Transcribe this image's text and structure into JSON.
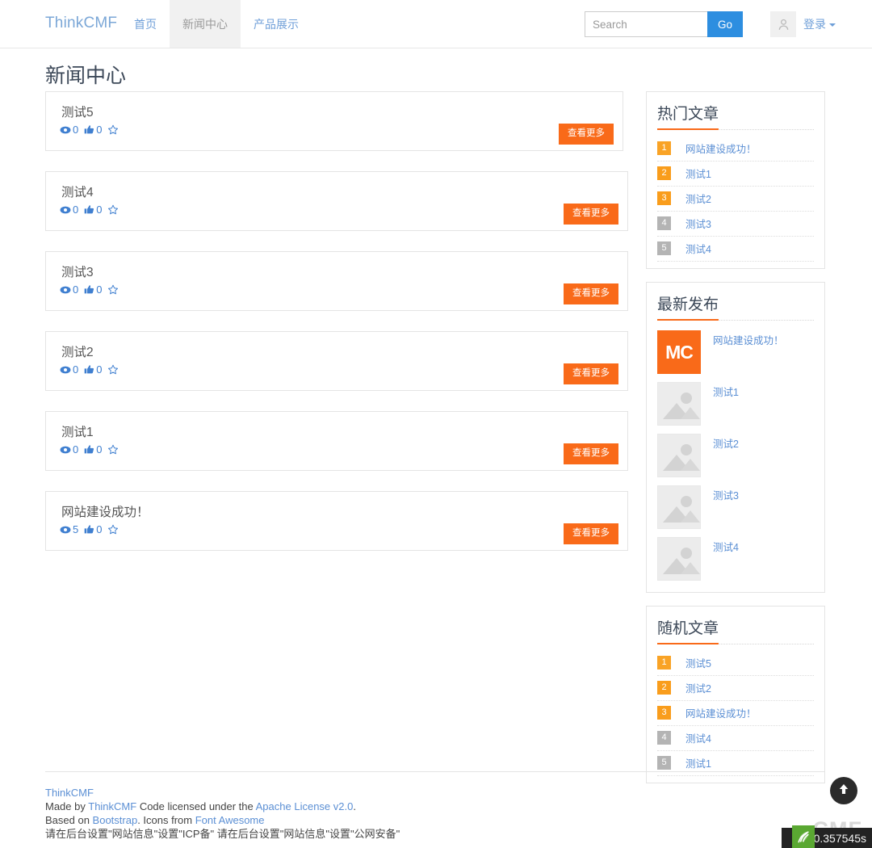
{
  "navbar": {
    "brand": "ThinkCMF",
    "links": [
      {
        "label": "首页",
        "active": false
      },
      {
        "label": "新闻中心",
        "active": true
      },
      {
        "label": "产品展示",
        "active": false
      }
    ],
    "search": {
      "placeholder": "Search",
      "value": "",
      "button_label": "Go"
    },
    "user": {
      "login_label": "登录",
      "avatar_icon": "user-icon",
      "caret_icon": "caret-down-icon"
    }
  },
  "page": {
    "title": "新闻中心"
  },
  "articles": {
    "more_label": "查看更多",
    "view_icon": "eye-icon",
    "like_icon": "thumbs-up-icon",
    "star_icon": "star-outline-icon",
    "items": [
      {
        "title": "测试5",
        "views": "0",
        "likes": "0"
      },
      {
        "title": "测试4",
        "views": "0",
        "likes": "0"
      },
      {
        "title": "测试3",
        "views": "0",
        "likes": "0"
      },
      {
        "title": "测试2",
        "views": "0",
        "likes": "0"
      },
      {
        "title": "测试1",
        "views": "0",
        "likes": "0"
      },
      {
        "title": "网站建设成功！",
        "views": "5",
        "likes": "0"
      }
    ]
  },
  "sidebar": {
    "hot": {
      "title": "热门文章",
      "items": [
        {
          "rank": "1",
          "label": "网站建设成功！"
        },
        {
          "rank": "2",
          "label": "测试1"
        },
        {
          "rank": "3",
          "label": "测试2"
        },
        {
          "rank": "4",
          "label": "测试3"
        },
        {
          "rank": "5",
          "label": "测试4"
        }
      ]
    },
    "latest": {
      "title": "最新发布",
      "items": [
        {
          "label": "网站建设成功！",
          "thumb": "mc-logo",
          "thumb_text": "MC"
        },
        {
          "label": "测试1",
          "thumb": "image-placeholder-icon"
        },
        {
          "label": "测试2",
          "thumb": "image-placeholder-icon"
        },
        {
          "label": "测试3",
          "thumb": "image-placeholder-icon"
        },
        {
          "label": "测试4",
          "thumb": "image-placeholder-icon"
        }
      ]
    },
    "random": {
      "title": "随机文章",
      "items": [
        {
          "rank": "1",
          "label": "测试5"
        },
        {
          "rank": "2",
          "label": "测试2"
        },
        {
          "rank": "3",
          "label": "网站建设成功！"
        },
        {
          "rank": "4",
          "label": "测试4"
        },
        {
          "rank": "5",
          "label": "测试1"
        }
      ]
    }
  },
  "footer": {
    "brand_link": "ThinkCMF",
    "line2_a": "Made by ",
    "line2_link1": "ThinkCMF",
    "line2_b": " Code licensed under the ",
    "line2_link2": "Apache License v2.0",
    "line2_c": ".",
    "line3_a": "Based on ",
    "line3_link1": "Bootstrap",
    "line3_b": ". Icons from ",
    "line3_link2": "Font Awesome",
    "line4": "请在后台设置\"网站信息\"设置\"ICP备\" 请在后台设置\"网站信息\"设置\"公网安备\""
  },
  "overlays": {
    "to_top_icon": "arrow-up-icon",
    "watermark_text": "CMF",
    "debug_time": "0.357545s",
    "leaf_icon": "thinkphp-leaf-icon"
  },
  "colors": {
    "brand_blue": "#7ba7d7",
    "link_blue": "#5b8fd4",
    "accent_orange": "#f96a19",
    "badge_orange": "#f99d1c",
    "badge_gray": "#b4b4b4",
    "search_btn_blue": "#2d8ee0"
  }
}
